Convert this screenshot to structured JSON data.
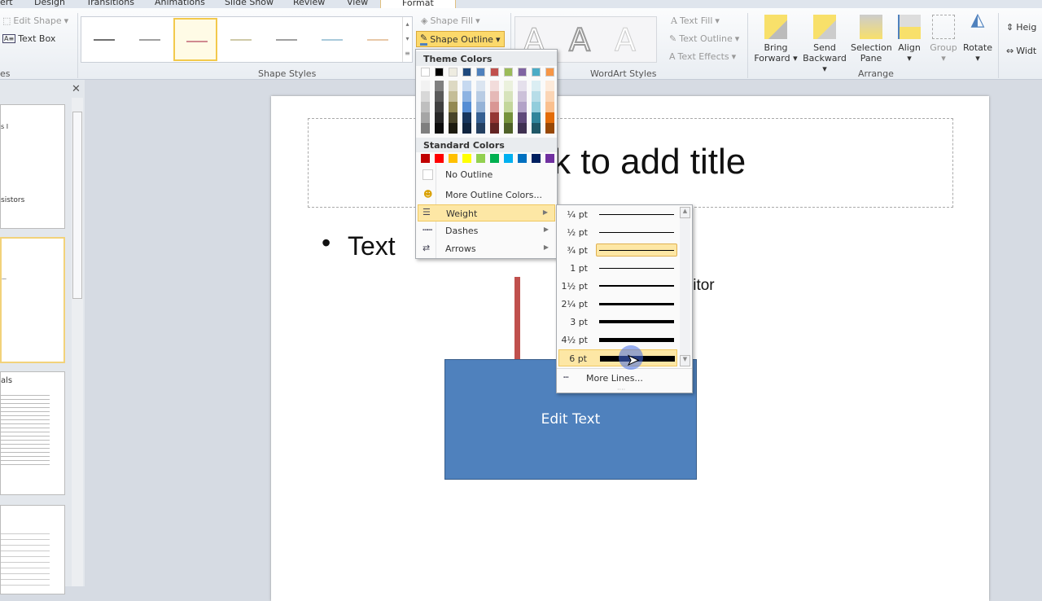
{
  "tabs": [
    "ert",
    "Design",
    "Transitions",
    "Animations",
    "Slide Show",
    "Review",
    "View",
    "Format"
  ],
  "ribbon": {
    "insert_shapes": {
      "edit_shape": "Edit Shape",
      "text_box": "Text Box",
      "label": "es"
    },
    "shape_styles": {
      "label": "Shape Styles",
      "line_colors": [
        "#707070",
        "#a0a0a0",
        "#d08a90",
        "#cfc9a8",
        "#a0a0a0",
        "#a9cadb",
        "#e8c8a8"
      ]
    },
    "shape_fill": "Shape Fill",
    "shape_outline": "Shape Outline",
    "wordart": {
      "label": "WordArt Styles",
      "text_fill": "Text Fill",
      "text_outline": "Text Outline",
      "text_effects": "Text Effects"
    },
    "arrange": {
      "label": "Arrange",
      "bring_forward": [
        "Bring",
        "Forward"
      ],
      "send_backward": [
        "Send",
        "Backward"
      ],
      "selection_pane": [
        "Selection",
        "Pane"
      ],
      "align": "Align",
      "group": "Group",
      "rotate": "Rotate"
    },
    "size": {
      "height": "Heig",
      "width": "Widt"
    }
  },
  "thumbnails": [
    {
      "lines": [
        "s I",
        "sistors"
      ]
    },
    {
      "lines": [
        "—"
      ]
    },
    {
      "lines": [
        "als"
      ]
    },
    {
      "lines": []
    }
  ],
  "slide": {
    "title": "k to add title",
    "bullet": "Text",
    "partial_text": "litor",
    "shape_text": "Edit Text"
  },
  "outline_menu": {
    "theme_colors_label": "Theme Colors",
    "theme_top": [
      "#ffffff",
      "#000000",
      "#eeece1",
      "#1f497d",
      "#4f81bd",
      "#c0504d",
      "#9bbb59",
      "#8064a2",
      "#4bacc6",
      "#f79646"
    ],
    "theme_shades": [
      [
        "#f2f2f2",
        "#d8d8d8",
        "#bfbfbf",
        "#a5a5a5",
        "#7f7f7f"
      ],
      [
        "#7f7f7f",
        "#595959",
        "#3f3f3f",
        "#262626",
        "#0c0c0c"
      ],
      [
        "#ddd9c3",
        "#c4bd97",
        "#938953",
        "#494429",
        "#1d1b10"
      ],
      [
        "#c6d9f0",
        "#8db3e2",
        "#548dd4",
        "#17365d",
        "#0f243e"
      ],
      [
        "#dbe5f1",
        "#b8cce4",
        "#95b3d7",
        "#366092",
        "#244061"
      ],
      [
        "#f2dcdb",
        "#e5b9b7",
        "#d99694",
        "#953734",
        "#632423"
      ],
      [
        "#ebf1dd",
        "#d7e3bc",
        "#c3d69b",
        "#76923c",
        "#4f6128"
      ],
      [
        "#e5e0ec",
        "#ccc1d9",
        "#b2a2c7",
        "#5f497a",
        "#3f3151"
      ],
      [
        "#dbeef3",
        "#b7dde8",
        "#92cddc",
        "#31859b",
        "#205867"
      ],
      [
        "#fdeada",
        "#fbd5b5",
        "#fac08f",
        "#e36c09",
        "#974806"
      ]
    ],
    "standard_colors_label": "Standard Colors",
    "standard": [
      "#c00000",
      "#ff0000",
      "#ffc000",
      "#ffff00",
      "#92d050",
      "#00b050",
      "#00b0f0",
      "#0070c0",
      "#002060",
      "#7030a0"
    ],
    "no_outline": "No Outline",
    "more_colors": "More Outline Colors...",
    "weight": "Weight",
    "dashes": "Dashes",
    "arrows": "Arrows"
  },
  "weight_menu": {
    "items": [
      {
        "label": "¼ pt",
        "w": 0.25
      },
      {
        "label": "½ pt",
        "w": 0.5
      },
      {
        "label": "¾ pt",
        "w": 0.75
      },
      {
        "label": "1 pt",
        "w": 1
      },
      {
        "label": "1½ pt",
        "w": 1.5
      },
      {
        "label": "2¼ pt",
        "w": 2.25
      },
      {
        "label": "3 pt",
        "w": 3
      },
      {
        "label": "4½ pt",
        "w": 4.5
      },
      {
        "label": "6 pt",
        "w": 6
      }
    ],
    "selected": "¾ pt",
    "hovered": "6 pt",
    "more_lines": "More Lines..."
  }
}
